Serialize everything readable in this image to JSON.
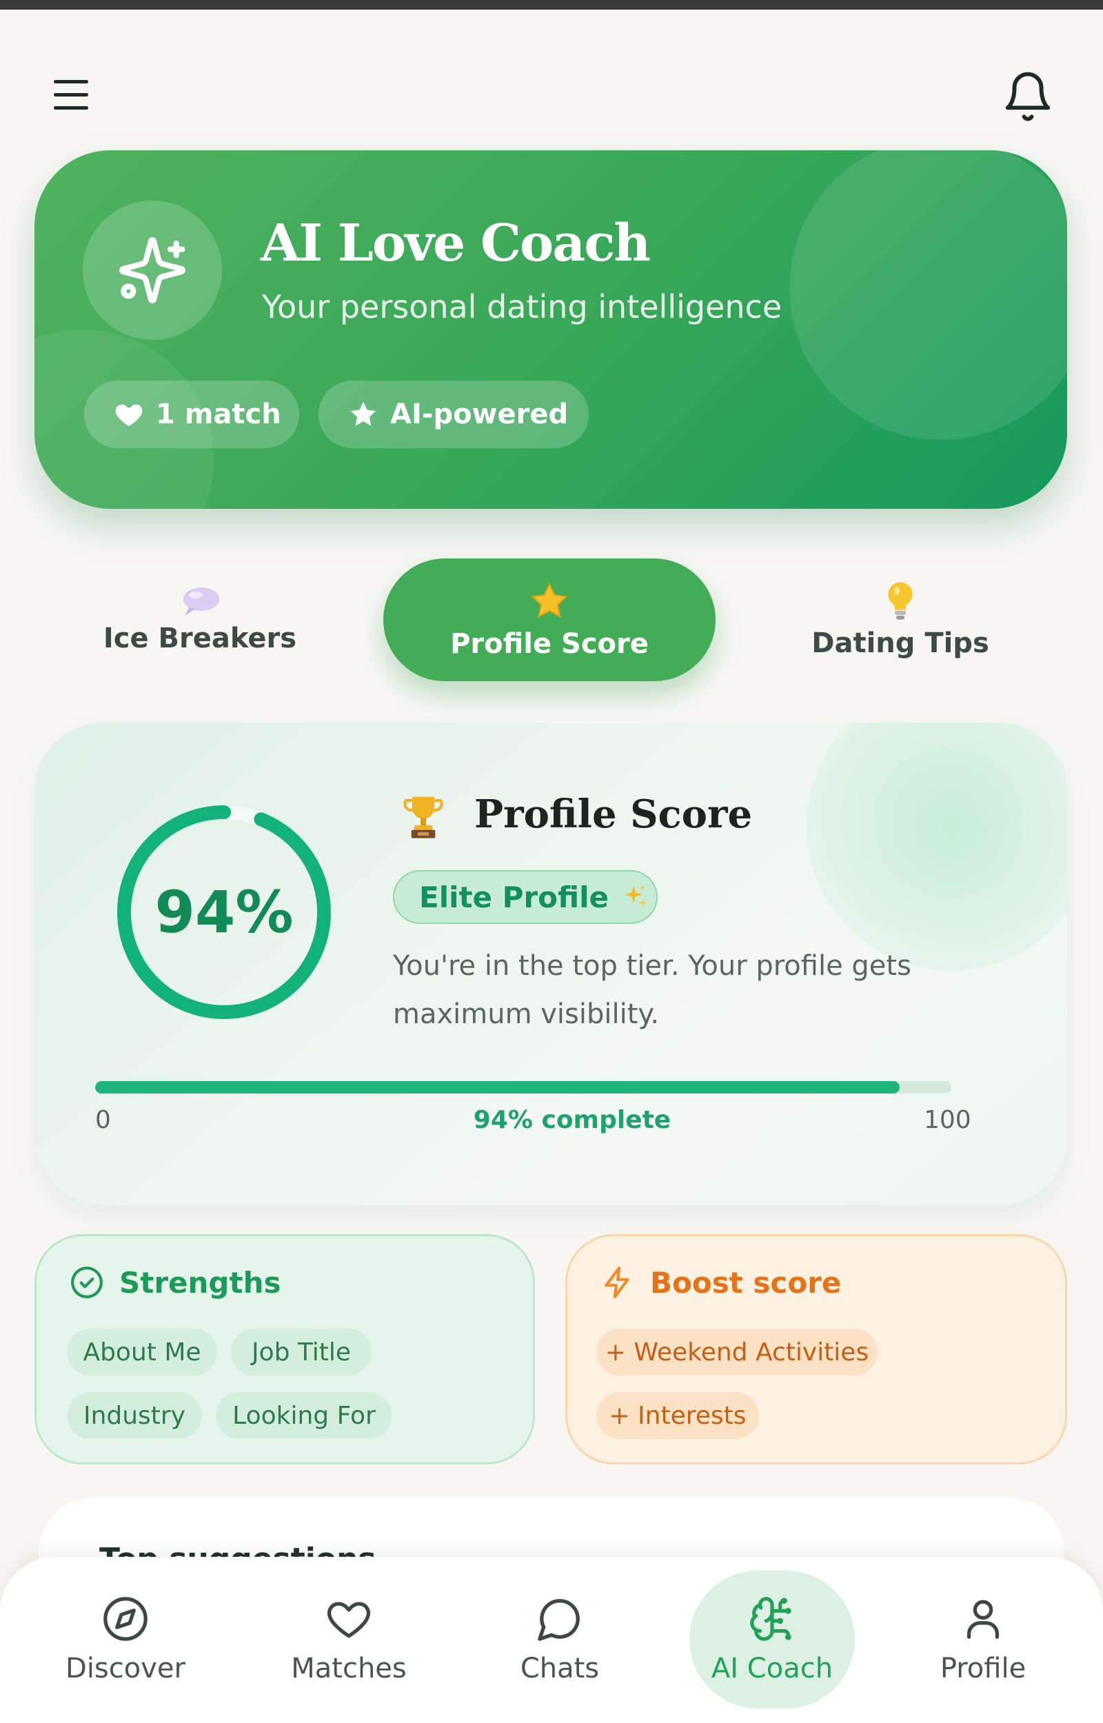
{
  "header": {
    "menu_icon": "hamburger-menu-icon",
    "bell_icon": "bell-icon"
  },
  "hero": {
    "title": "AI Love Coach",
    "subtitle": "Your personal dating intelligence",
    "icon": "sparkles-icon",
    "pills": [
      {
        "icon": "heart-icon",
        "label": "1 match"
      },
      {
        "icon": "star-icon",
        "label": "AI-powered"
      }
    ]
  },
  "tabs": [
    {
      "icon": "speech-bubble-icon",
      "label": "Ice Breakers",
      "active": false
    },
    {
      "icon": "star-icon",
      "label": "Profile Score",
      "active": true
    },
    {
      "icon": "lightbulb-icon",
      "label": "Dating Tips",
      "active": false
    }
  ],
  "score": {
    "value_text": "94%",
    "value": 94,
    "title": "Profile Score",
    "badge": "Elite Profile",
    "description": "You're in the top tier. Your profile gets maximum visibility.",
    "scale_min": "0",
    "scale_max": "100",
    "progress_label": "94% complete",
    "progress_fraction": 0.94
  },
  "strengths": {
    "title": "Strengths",
    "items": [
      "About Me",
      "Job Title",
      "Industry",
      "Looking For"
    ]
  },
  "boost": {
    "title": "Boost score",
    "items": [
      "+ Weekend Activities",
      "+ Interests"
    ]
  },
  "next_section": {
    "heading": "Top suggestions"
  },
  "bottom_nav": [
    {
      "icon": "compass-icon",
      "label": "Discover",
      "active": false
    },
    {
      "icon": "heart-icon",
      "label": "Matches",
      "active": false
    },
    {
      "icon": "chat-bubble-icon",
      "label": "Chats",
      "active": false
    },
    {
      "icon": "brain-icon",
      "label": "AI Coach",
      "active": true
    },
    {
      "icon": "person-icon",
      "label": "Profile",
      "active": false
    }
  ],
  "colors": {
    "brand_green": "#43ac57",
    "score_green": "#1fb57a",
    "boost_orange": "#e3741c",
    "background": "#f7f6f3"
  }
}
